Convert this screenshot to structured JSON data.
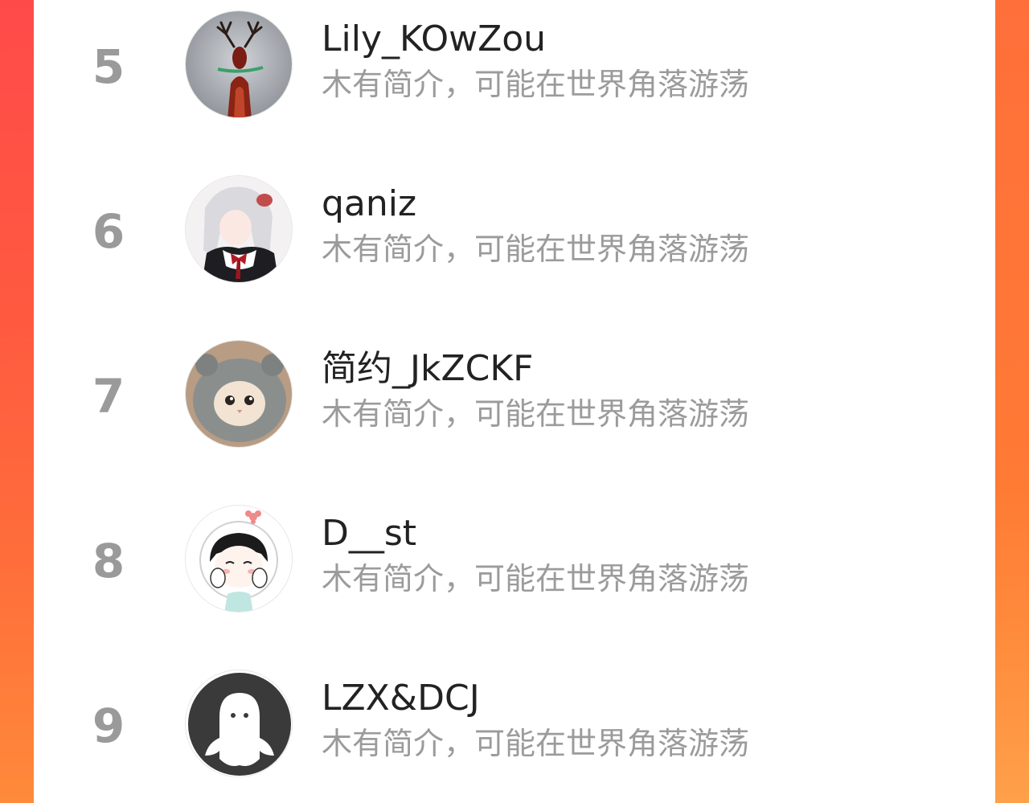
{
  "colors": {
    "background_gradient_start": "#ff4a4a",
    "background_gradient_end": "#ff8a3a",
    "card": "#ffffff",
    "rank_text": "#9a9a9a",
    "name_text": "#222222",
    "bio_text": "#9b9b9b"
  },
  "ranking": {
    "users": [
      {
        "rank": "5",
        "name": "Lily_KOwZou",
        "bio": "木有简介，可能在世界角落游荡",
        "avatar_icon": "antler-deer-avatar"
      },
      {
        "rank": "6",
        "name": "qaniz",
        "bio": "木有简介，可能在世界角落游荡",
        "avatar_icon": "anime-maid-girl-avatar"
      },
      {
        "rank": "7",
        "name": "简约_JkZCKF",
        "bio": "木有简介，可能在世界角落游荡",
        "avatar_icon": "kitten-in-hood-avatar"
      },
      {
        "rank": "8",
        "name": "D__st",
        "bio": "木有简介，可能在世界角落游荡",
        "avatar_icon": "cartoon-girl-astronaut-avatar"
      },
      {
        "rank": "9",
        "name": "LZX&DCJ",
        "bio": "木有简介，可能在世界角落游荡",
        "avatar_icon": "default-ghost-avatar"
      }
    ]
  }
}
